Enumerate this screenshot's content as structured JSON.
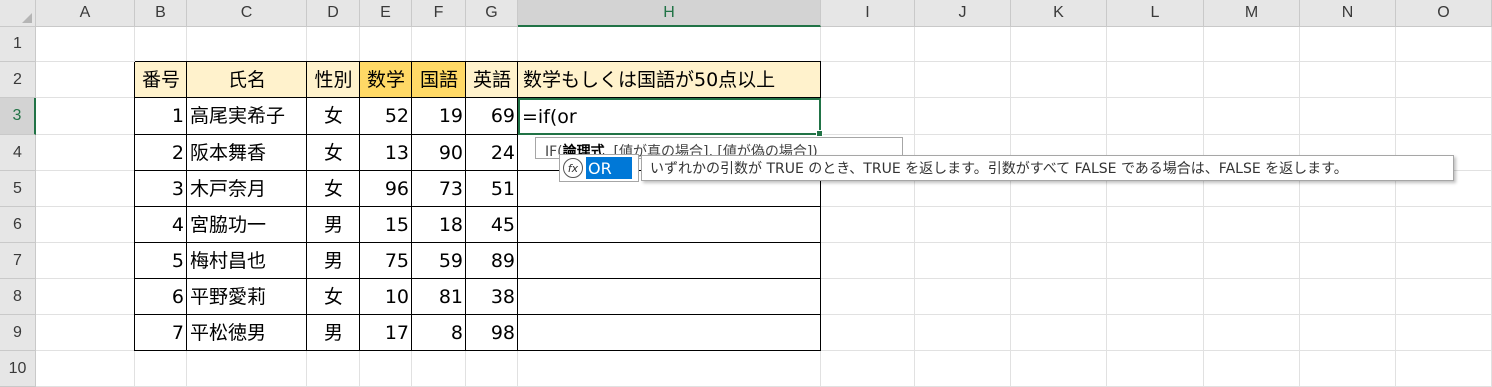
{
  "columns": [
    "A",
    "B",
    "C",
    "D",
    "E",
    "F",
    "G",
    "H",
    "I",
    "J",
    "K",
    "L",
    "M",
    "N",
    "O"
  ],
  "rows": [
    "1",
    "2",
    "3",
    "4",
    "5",
    "6",
    "7",
    "8",
    "9",
    "10"
  ],
  "selected_column": "H",
  "selected_row": "3",
  "table": {
    "headers": [
      "番号",
      "氏名",
      "性別",
      "数学",
      "国語",
      "英語",
      "数学もしくは国語が50点以上"
    ],
    "records": [
      [
        "1",
        "高尾実希子",
        "女",
        "52",
        "19",
        "69"
      ],
      [
        "2",
        "阪本舞香",
        "女",
        "13",
        "90",
        "24"
      ],
      [
        "3",
        "木戸奈月",
        "女",
        "96",
        "73",
        "51"
      ],
      [
        "4",
        "宮脇功一",
        "男",
        "15",
        "18",
        "45"
      ],
      [
        "5",
        "梅村昌也",
        "男",
        "75",
        "59",
        "89"
      ],
      [
        "6",
        "平野愛莉",
        "女",
        "10",
        "81",
        "38"
      ],
      [
        "7",
        "平松徳男",
        "男",
        "17",
        "8",
        "98"
      ]
    ]
  },
  "active_cell": {
    "ref": "H3",
    "formula": "=if(or"
  },
  "tooltip": {
    "prefix": "IF(",
    "bold_arg": "論理式",
    "rest": ", [値が真の場合], [値が偽の場合])"
  },
  "autocomplete": {
    "icon": "fx",
    "function": "OR",
    "description": "いずれかの引数が TRUE のとき、TRUE を返します。引数がすべて FALSE である場合は、FALSE を返します。"
  },
  "colors": {
    "header_fill": "#fff2cc",
    "highlight_fill": "#ffd966",
    "selection": "#217346",
    "autocomplete_selected": "#0078d7"
  }
}
